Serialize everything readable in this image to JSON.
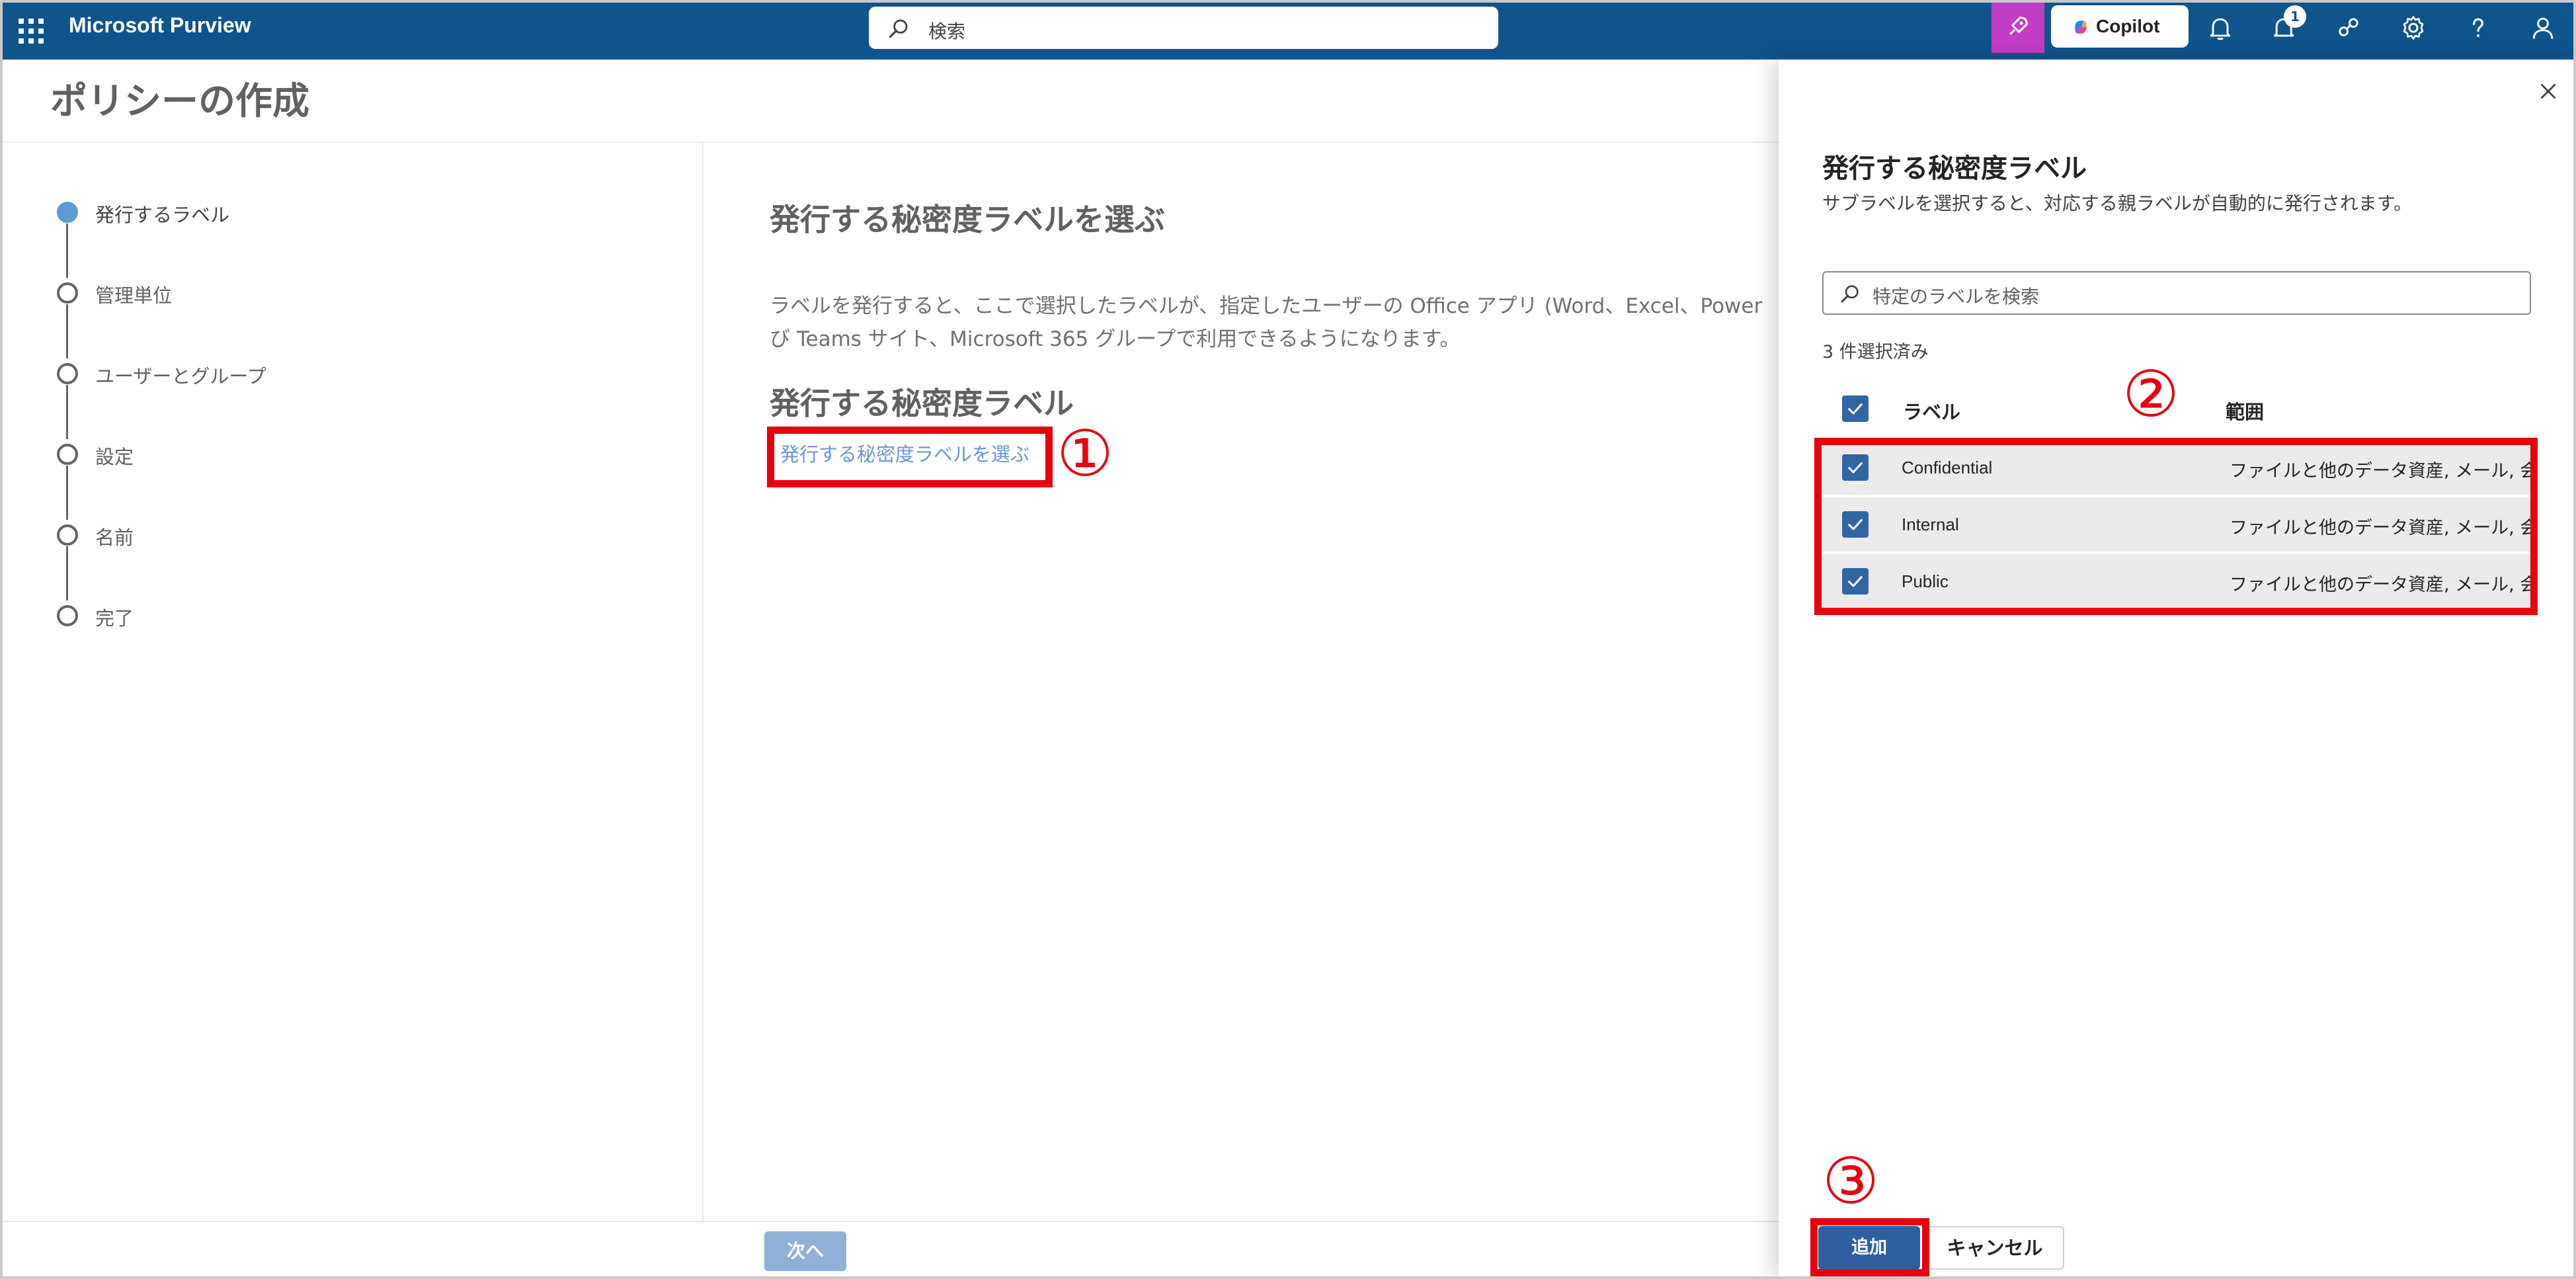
{
  "app": {
    "title": "Microsoft Purview",
    "search_placeholder": "検索",
    "copilot_label": "Copilot",
    "notification_badge": "1"
  },
  "page": {
    "title": "ポリシーの作成"
  },
  "steps": [
    {
      "label": "発行するラベル",
      "active": true
    },
    {
      "label": "管理単位",
      "active": false
    },
    {
      "label": "ユーザーとグループ",
      "active": false
    },
    {
      "label": "設定",
      "active": false
    },
    {
      "label": "名前",
      "active": false
    },
    {
      "label": "完了",
      "active": false
    }
  ],
  "main": {
    "heading": "発行する秘密度ラベルを選ぶ",
    "description_line1": "ラベルを発行すると、ここで選択したラベルが、指定したユーザーの Office アプリ (Word、Excel、Power",
    "description_line2": "び Teams サイト、Microsoft 365 グループで利用できるようになります。",
    "subheading": "発行する秘密度ラベル",
    "choose_link": "発行する秘密度ラベルを選ぶ",
    "next_button": "次へ"
  },
  "annotations": {
    "one": "①",
    "two": "②",
    "three": "③"
  },
  "panel": {
    "title": "発行する秘密度ラベル",
    "description": "サブラベルを選択すると、対応する親ラベルが自動的に発行されます。",
    "search_placeholder": "特定のラベルを検索",
    "selected_count": "3 件選択済み",
    "columns": {
      "label": "ラベル",
      "scope": "範囲"
    },
    "rows": [
      {
        "label": "Confidential",
        "scope": "ファイルと他のデータ資産, メール, 会議"
      },
      {
        "label": "Internal",
        "scope": "ファイルと他のデータ資産, メール, 会議"
      },
      {
        "label": "Public",
        "scope": "ファイルと他のデータ資産, メール, 会議"
      }
    ],
    "add_button": "追加",
    "cancel_button": "キャンセル"
  },
  "colors": {
    "topbar": "#0f548c",
    "accent": "#2f5fa0",
    "annotation_red": "#e8000c",
    "copilot_pink": "#c13bc4"
  }
}
